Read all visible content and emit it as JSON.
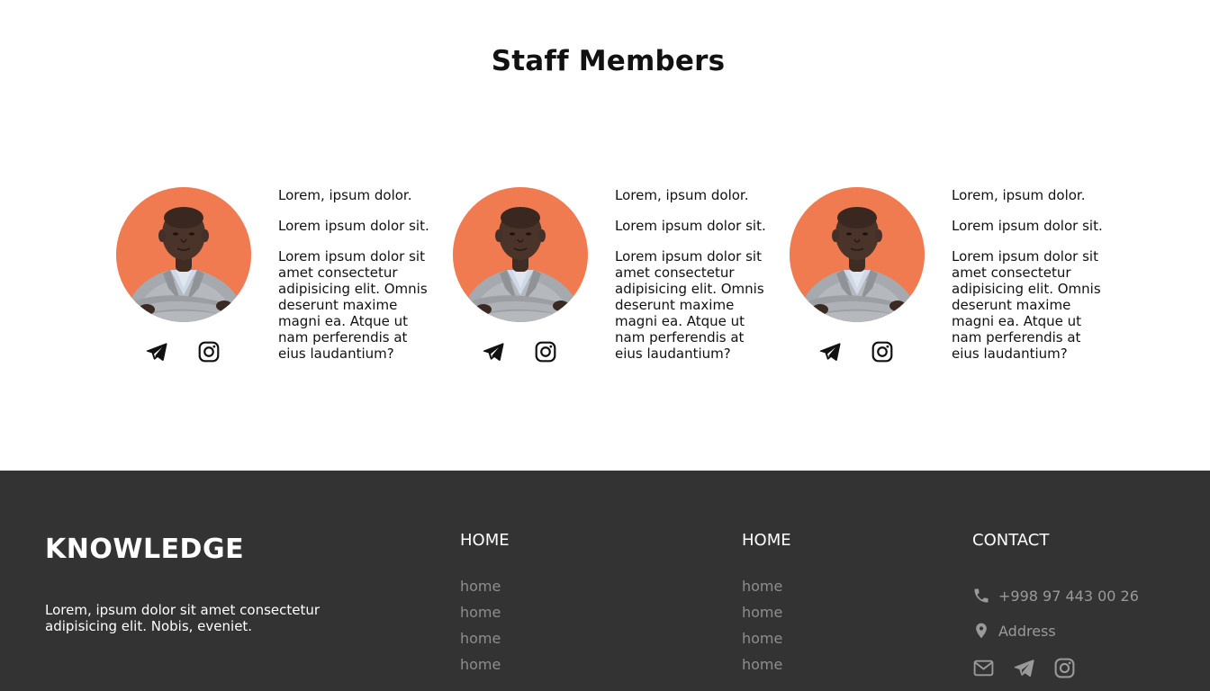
{
  "section": {
    "title": "Staff Members"
  },
  "staff": [
    {
      "name": "Lorem, ipsum dolor.",
      "role": "Lorem ipsum dolor sit.",
      "description": "Lorem ipsum dolor sit amet consectetur adipisicing elit. Omnis deserunt maxime magni ea. Atque ut nam perferendis at eius laudantium?"
    },
    {
      "name": "Lorem, ipsum dolor.",
      "role": "Lorem ipsum dolor sit.",
      "description": "Lorem ipsum dolor sit amet consectetur adipisicing elit. Omnis deserunt maxime magni ea. Atque ut nam perferendis at eius laudantium?"
    },
    {
      "name": "Lorem, ipsum dolor.",
      "role": "Lorem ipsum dolor sit.",
      "description": "Lorem ipsum dolor sit amet consectetur adipisicing elit. Omnis deserunt maxime magni ea. Atque ut nam perferendis at eius laudantium?"
    }
  ],
  "staff_icons": [
    "telegram-icon",
    "instagram-icon"
  ],
  "footer": {
    "brand": "KNOWLEDGE",
    "description": "Lorem, ipsum dolor sit amet consectetur adipisicing elit. Nobis, eveniet.",
    "columns": [
      {
        "title": "HOME",
        "links": [
          "home",
          "home",
          "home",
          "home"
        ]
      },
      {
        "title": "HOME",
        "links": [
          "home",
          "home",
          "home",
          "home"
        ]
      }
    ],
    "contact": {
      "title": "CONTACT",
      "phone": "+998 97 443 00 26",
      "address": "Address",
      "icons": [
        "mail-icon",
        "telegram-icon",
        "instagram-icon"
      ]
    }
  },
  "colors": {
    "footer_bg": "#333333",
    "photo_bg": "#ef7a4f",
    "link_gray": "#8e8e8e",
    "heading": "#111111"
  }
}
